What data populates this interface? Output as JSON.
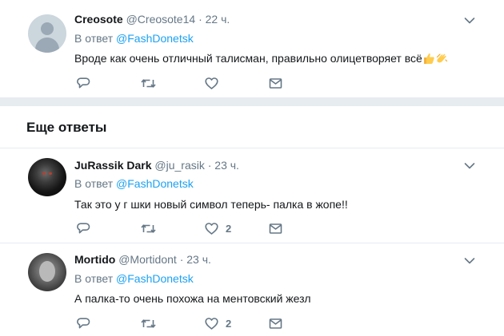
{
  "tweets": [
    {
      "name": "Creosote",
      "handle": "@Creosote14",
      "time": "· 22 ч.",
      "reply_prefix": "В ответ",
      "reply_mention": "@FashDonetsk",
      "text": "Вроде как очень отличный талисман, правильно олицетворяет всё",
      "emojis": [
        "thumbs-up-emoji",
        "clapping-hands-emoji"
      ],
      "likes": "",
      "avatar": "default-avatar"
    },
    {
      "name": "JuRassik Dark",
      "handle": "@ju_rasik",
      "time": "· 23 ч.",
      "reply_prefix": "В ответ",
      "reply_mention": "@FashDonetsk",
      "text": "Так это у г  шки новый символ теперь- палка в жопе!!",
      "likes": "2",
      "avatar": "dark-avatar"
    },
    {
      "name": "Mortido",
      "handle": "@Mortidont",
      "time": "· 23 ч.",
      "reply_prefix": "В ответ",
      "reply_mention": "@FashDonetsk",
      "text": "А палка-то очень похожа на ментовский жезл",
      "likes": "2",
      "avatar": "gray-avatar"
    }
  ],
  "section": {
    "title": "Еще ответы"
  },
  "colors": {
    "accent": "#1da1f2",
    "icon": "#657786",
    "divider": "#e6ecf0"
  },
  "icons": [
    "reply-icon",
    "retweet-icon",
    "like-icon",
    "direct-message-icon",
    "chevron-down-icon"
  ]
}
